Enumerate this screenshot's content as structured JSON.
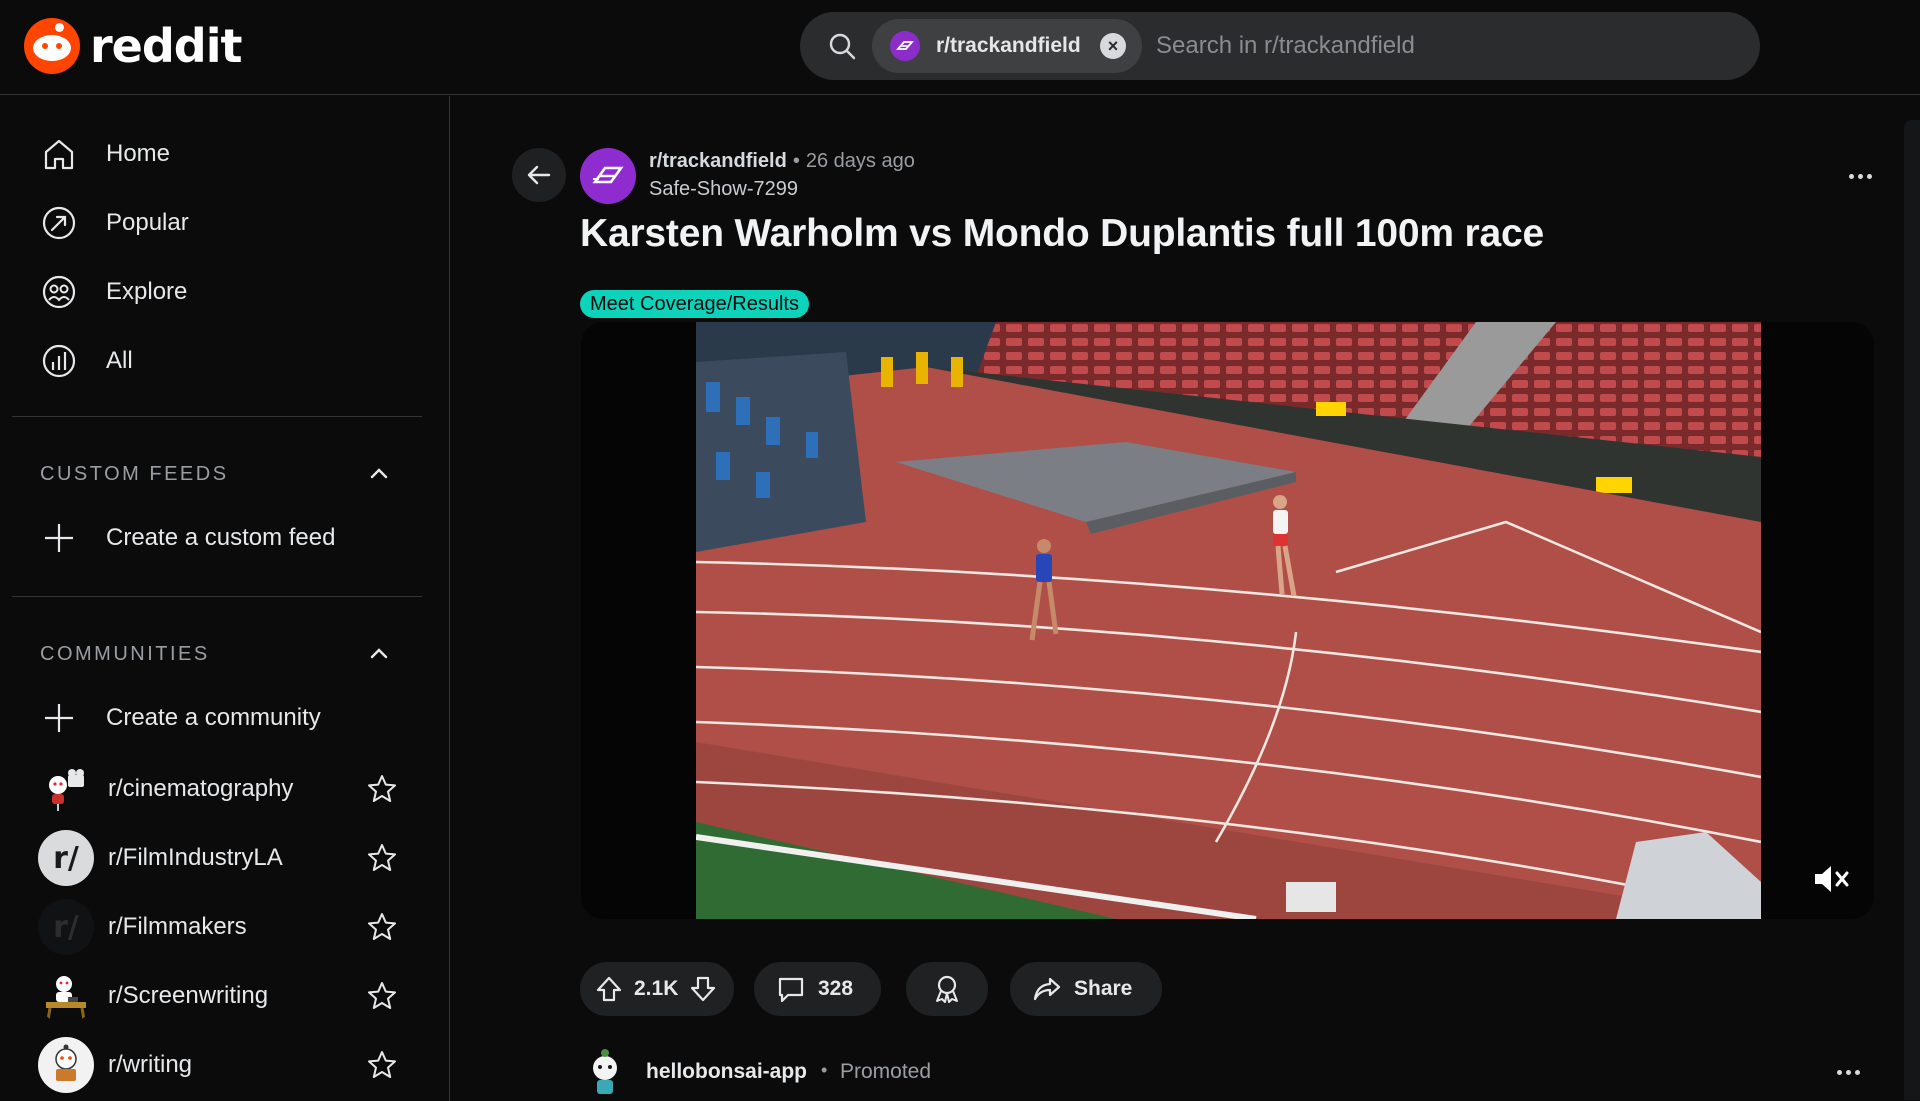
{
  "brand": {
    "name": "reddit",
    "color": "#ff4500"
  },
  "search": {
    "scope_chip": "r/trackandfield",
    "placeholder": "Search in r/trackandfield"
  },
  "sidebar": {
    "nav": [
      {
        "label": "Home",
        "icon": "home-icon"
      },
      {
        "label": "Popular",
        "icon": "popular-icon"
      },
      {
        "label": "Explore",
        "icon": "explore-icon"
      },
      {
        "label": "All",
        "icon": "all-icon"
      }
    ],
    "custom_feeds": {
      "title": "CUSTOM FEEDS",
      "create_label": "Create a custom feed"
    },
    "communities": {
      "title": "COMMUNITIES",
      "create_label": "Create a community",
      "items": [
        {
          "label": "r/cinematography"
        },
        {
          "label": "r/FilmIndustryLA"
        },
        {
          "label": "r/Filmmakers"
        },
        {
          "label": "r/Screenwriting"
        },
        {
          "label": "r/writing"
        }
      ]
    }
  },
  "post": {
    "subreddit": "r/trackandfield",
    "separator": "•",
    "time_ago": "26 days ago",
    "author": "Safe-Show-7299",
    "title": "Karsten Warholm vs Mondo Duplantis full 100m race",
    "flair": "Meet Coverage/Results",
    "flair_color": "#0dd3bb",
    "votes": "2.1K",
    "comments": "328",
    "share_label": "Share"
  },
  "promoted": {
    "name": "hellobonsai-app",
    "separator": "•",
    "tag": "Promoted"
  }
}
